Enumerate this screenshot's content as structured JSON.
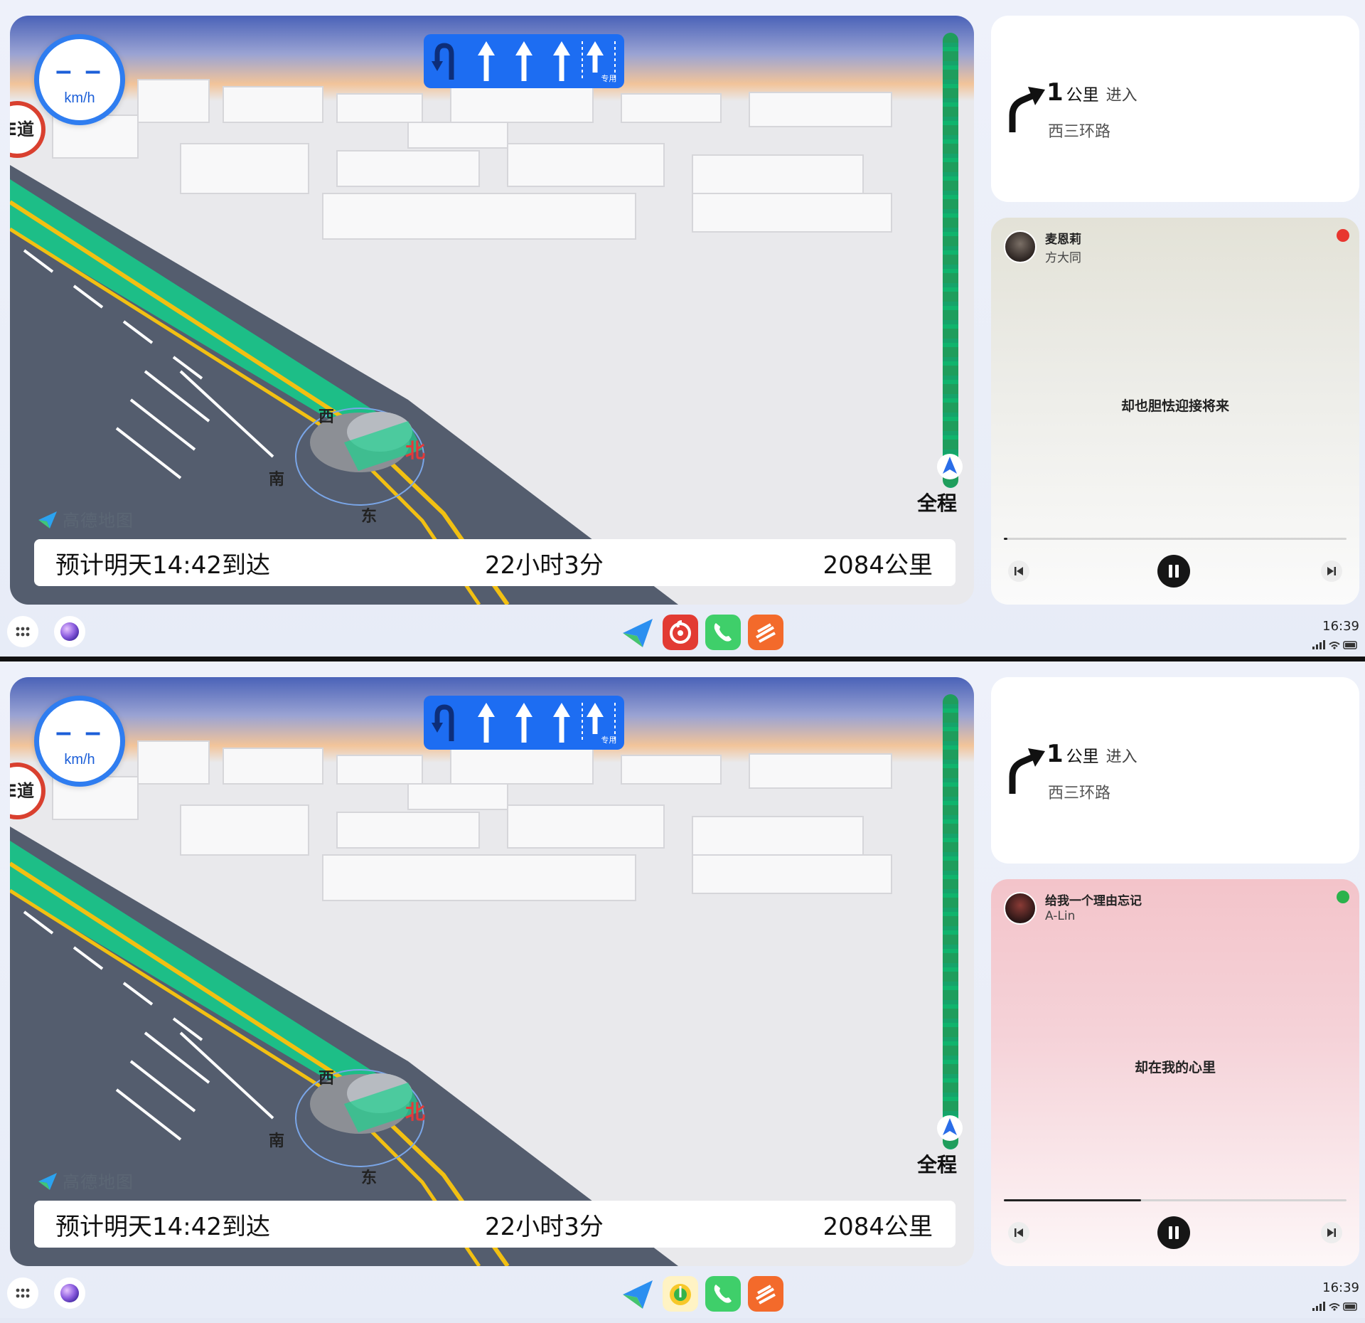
{
  "screens": [
    {
      "speed": {
        "value": "– –",
        "unit": "km/h"
      },
      "lane_badge": "E道",
      "lane_special_label": "专用",
      "compass": {
        "west": "西",
        "north": "北",
        "south": "南",
        "east": "东"
      },
      "map_brand": "高德地图",
      "overview_label": "全程",
      "eta": {
        "arrive": "预计明天14:42到达",
        "duration": "22小时3分",
        "distance": "2084公里"
      },
      "guide": {
        "distance": "1",
        "unit": "公里",
        "action": "进入",
        "road": "西三环路"
      },
      "music": {
        "song": "麦恩莉",
        "artist": "方大同",
        "lyric": "却也胆怯迎接将来",
        "progress": 0.01,
        "source_color": "#e8362f"
      },
      "dock": {
        "clock": "16:39",
        "apps": [
          "map-app-icon",
          "netease-music-icon",
          "phone-icon",
          "orange-app-icon"
        ]
      }
    },
    {
      "speed": {
        "value": "– –",
        "unit": "km/h"
      },
      "lane_badge": "E道",
      "lane_special_label": "专用",
      "compass": {
        "west": "西",
        "north": "北",
        "south": "南",
        "east": "东"
      },
      "map_brand": "高德地图",
      "overview_label": "全程",
      "eta": {
        "arrive": "预计明天14:42到达",
        "duration": "22小时3分",
        "distance": "2084公里"
      },
      "guide": {
        "distance": "1",
        "unit": "公里",
        "action": "进入",
        "road": "西三环路"
      },
      "music": {
        "song": "给我一个理由忘记",
        "artist": "A-Lin",
        "lyric": "却在我的心里",
        "progress": 0.4,
        "source_color": "#2bb24c"
      },
      "dock": {
        "clock": "16:39",
        "apps": [
          "map-app-icon",
          "qq-music-icon",
          "phone-icon",
          "orange-app-icon"
        ]
      }
    }
  ],
  "colors": {
    "accent_blue": "#1d6df2",
    "route_green": "#12c27a",
    "warning_red": "#d9402f"
  }
}
